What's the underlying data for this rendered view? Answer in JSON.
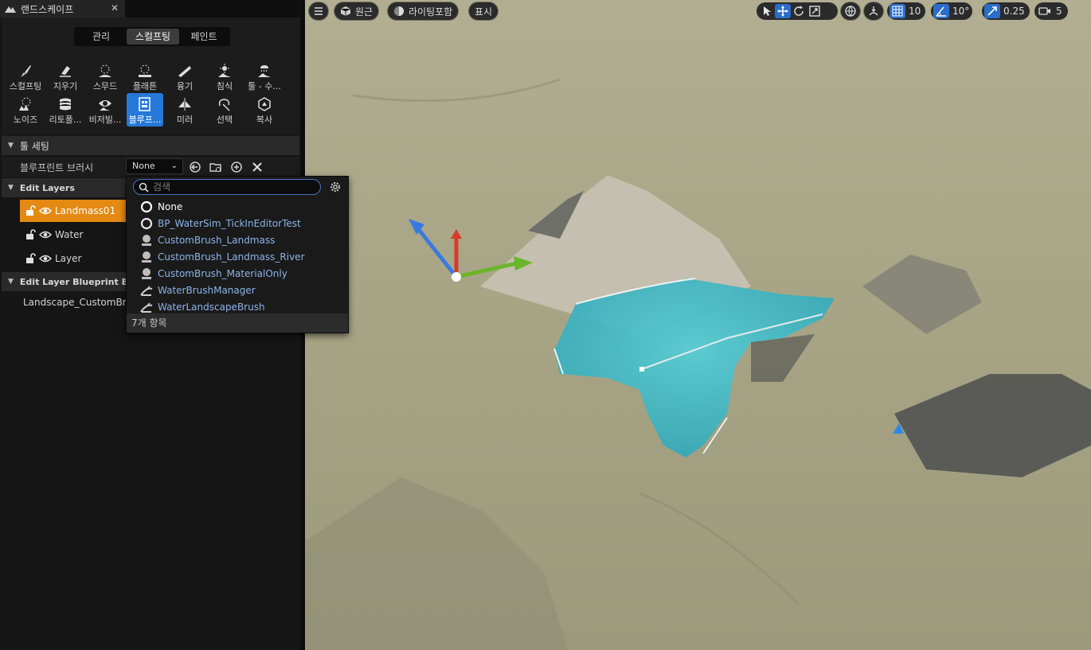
{
  "panel": {
    "tab_title": "랜드스케이프",
    "close_glyph": "✕",
    "modes": [
      "관리",
      "스컬프팅",
      "페인트"
    ],
    "active_mode": "스컬프팅",
    "tools": [
      {
        "label": "스컬프팅",
        "icon": "sculpt-brush-icon"
      },
      {
        "label": "지우기",
        "icon": "erase-icon"
      },
      {
        "label": "스무드",
        "icon": "smooth-icon"
      },
      {
        "label": "플래튼",
        "icon": "flatten-icon"
      },
      {
        "label": "융기",
        "icon": "ramp-icon"
      },
      {
        "label": "침식",
        "icon": "erosion-icon"
      },
      {
        "label": "툴 - 수...",
        "icon": "hydro-erosion-icon"
      },
      {
        "label": "노이즈",
        "icon": "noise-icon"
      },
      {
        "label": "리토폴...",
        "icon": "retopologize-icon"
      },
      {
        "label": "비저빌...",
        "icon": "visibility-icon"
      },
      {
        "label": "블루프...",
        "icon": "blueprint-icon",
        "active": true
      },
      {
        "label": "미러",
        "icon": "mirror-icon"
      },
      {
        "label": "선택",
        "icon": "select-icon"
      },
      {
        "label": "복사",
        "icon": "copy-icon"
      }
    ],
    "tool_settings_header": "툴 세팅",
    "blueprint_brush_label": "블루프린트 브러시",
    "blueprint_brush_value": "None",
    "edit_layers_header": "Edit Layers",
    "layers": [
      {
        "name": "Landmass01",
        "active": true
      },
      {
        "name": "Water",
        "active": false
      },
      {
        "name": "Layer",
        "active": false
      }
    ],
    "bp_brushes_header": "Edit Layer Blueprint Brushes",
    "bp_brush_item": "Landscape_CustomBrush"
  },
  "viewport_toolbar": {
    "menu_icon": "hamburger-icon",
    "perspective_label": "원근",
    "lighting_label": "라이팅포함",
    "show_label": "표시",
    "grid_snap": "10",
    "rotation_snap": "10°",
    "scale_snap": "0.25",
    "camera_speed": "5"
  },
  "dropdown": {
    "search_placeholder": "검색",
    "items": [
      {
        "label": "None",
        "icon": "none-circle-icon"
      },
      {
        "label": "BP_WaterSim_TickInEditorTest",
        "icon": "blueprint-class-icon"
      },
      {
        "label": "CustomBrush_Landmass",
        "icon": "brush-actor-icon"
      },
      {
        "label": "CustomBrush_Landmass_River",
        "icon": "brush-actor-icon"
      },
      {
        "label": "CustomBrush_MaterialOnly",
        "icon": "brush-actor-icon"
      },
      {
        "label": "WaterBrushManager",
        "icon": "water-brush-icon"
      },
      {
        "label": "WaterLandscapeBrush",
        "icon": "water-brush-icon"
      }
    ],
    "footer": "7개 항목"
  },
  "colors": {
    "accent_blue": "#2678d9",
    "active_layer_orange": "#e48a12",
    "link_blue": "#8cb4ea",
    "water": "#3bb8c4",
    "terrain": "#a6a586"
  }
}
